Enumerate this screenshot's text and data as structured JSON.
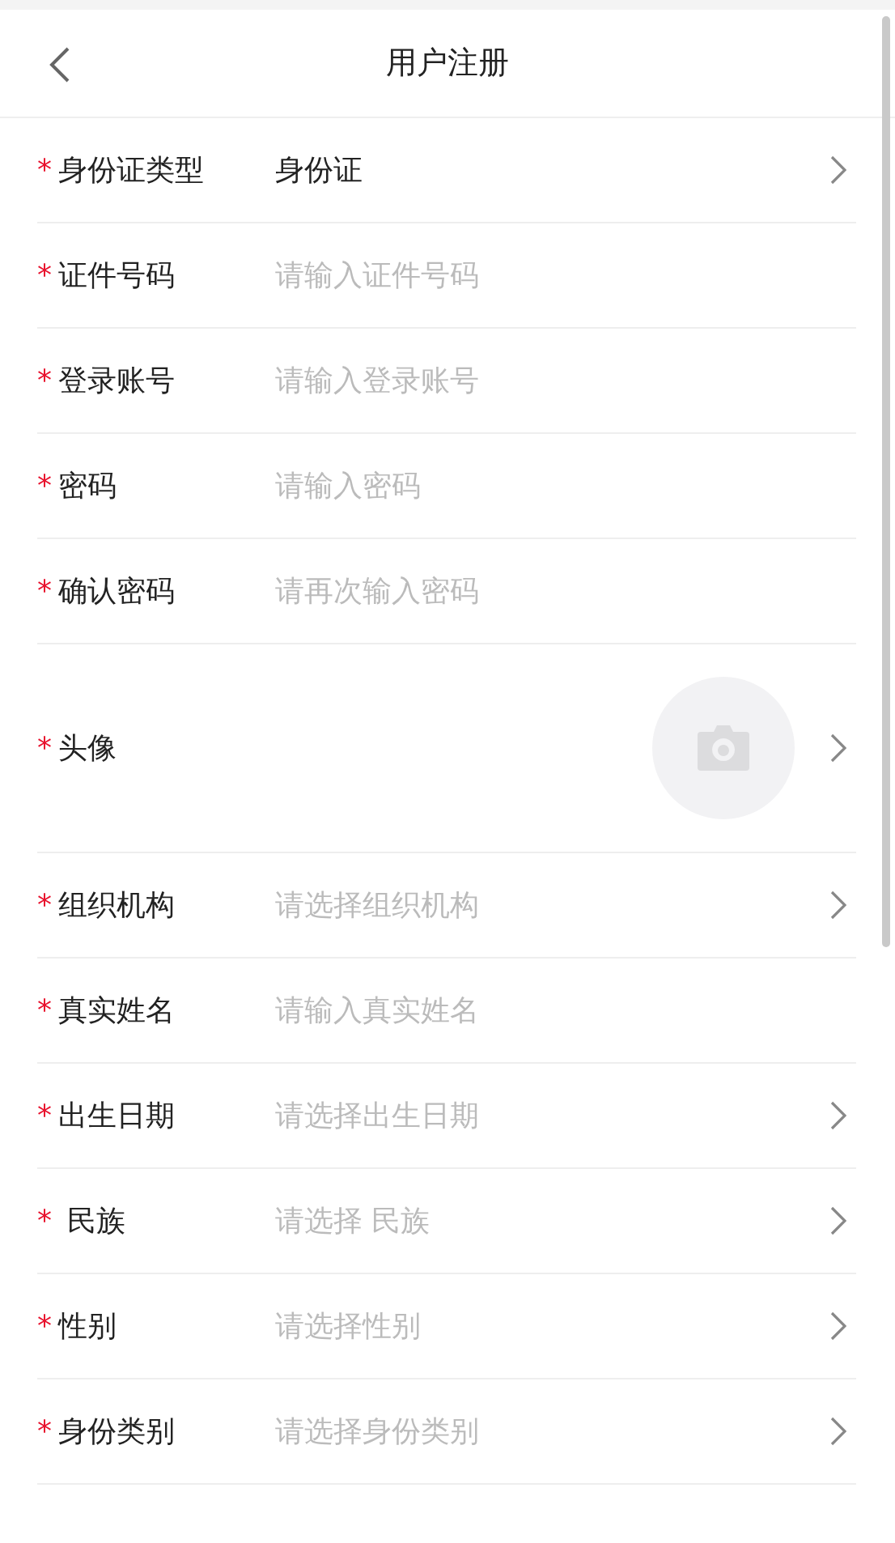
{
  "header": {
    "title": "用户注册"
  },
  "fields": [
    {
      "kind": "select",
      "mark": "*",
      "label": "身份证类型",
      "value": "身份证"
    },
    {
      "kind": "input",
      "mark": "*",
      "label": "证件号码",
      "placeholder": "请输入证件号码"
    },
    {
      "kind": "input",
      "mark": "*",
      "label": "登录账号",
      "placeholder": "请输入登录账号"
    },
    {
      "kind": "input",
      "mark": "*",
      "label": "密码",
      "placeholder": "请输入密码"
    },
    {
      "kind": "input",
      "mark": "*",
      "label": "确认密码",
      "placeholder": "请再次输入密码"
    },
    {
      "kind": "avatar",
      "mark": "*",
      "label": "头像"
    },
    {
      "kind": "select",
      "mark": "*",
      "label": "组织机构",
      "placeholder": "请选择组织机构"
    },
    {
      "kind": "input",
      "mark": "*",
      "label": "真实姓名",
      "placeholder": "请输入真实姓名"
    },
    {
      "kind": "select",
      "mark": "*",
      "label": "出生日期",
      "placeholder": "请选择出生日期"
    },
    {
      "kind": "select",
      "mark": "*",
      "label": " 民族",
      "placeholder": "请选择 民族"
    },
    {
      "kind": "select",
      "mark": "*",
      "label": "性别",
      "placeholder": "请选择性别"
    },
    {
      "kind": "select",
      "mark": "*",
      "label": "身份类别",
      "placeholder": "请选择身份类别"
    }
  ]
}
